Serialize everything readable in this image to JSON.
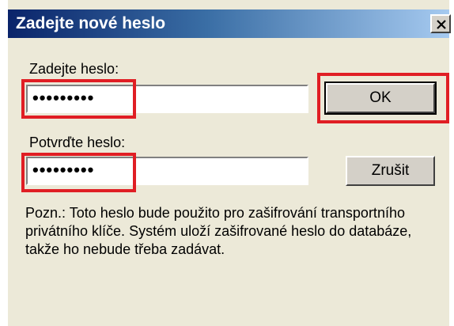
{
  "dialog": {
    "title": "Zadejte nové heslo",
    "close_icon": "close-icon",
    "password_label": "Zadejte heslo:",
    "password_value": "•••••••••",
    "confirm_label": "Potvrďte heslo:",
    "confirm_value": "•••••••••",
    "ok_label": "OK",
    "cancel_label": "Zrušit",
    "note": "Pozn.: Toto heslo bude použito pro zašifrování transportního privátního klíče. Systém uloží zašifrované heslo do databáze, takže ho nebude třeba zadávat."
  },
  "colors": {
    "title_bar_start": "#0a246a",
    "title_bar_end": "#a6caf0",
    "window_face": "#ece9d8",
    "highlight": "#e01e24"
  }
}
